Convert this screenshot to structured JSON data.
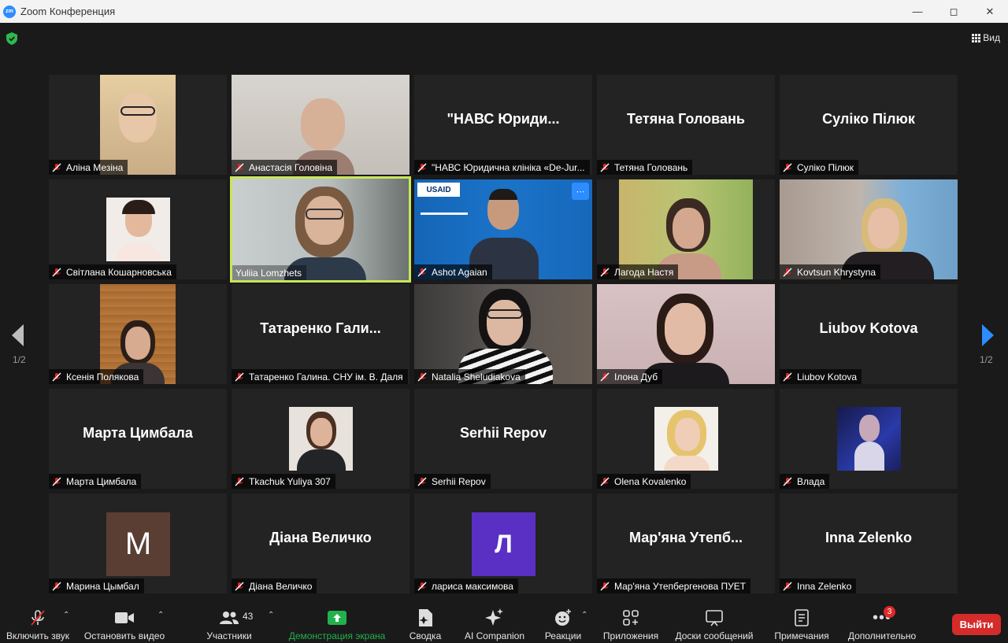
{
  "window": {
    "title": "Zoom Конференция",
    "logo": "zm"
  },
  "topbar": {
    "view_label": "Вид"
  },
  "navigation": {
    "page_left": "1/2",
    "page_right": "1/2"
  },
  "participants": [
    {
      "label": "Аліна Мезіна",
      "display": "video"
    },
    {
      "label": "Анастасія Головіна",
      "display": "video"
    },
    {
      "label": "\"НАВС Юридична клініка «De-Jur...",
      "display": "name",
      "big_name": "\"НАВС Юриди..."
    },
    {
      "label": "Тетяна Головань",
      "display": "name",
      "big_name": "Тетяна Головань"
    },
    {
      "label": "Суліко Пілюк",
      "display": "name",
      "big_name": "Суліко Пілюк"
    },
    {
      "label": "Світлана Кошарновська",
      "display": "video"
    },
    {
      "label": "Yuliia Lomzhets",
      "display": "video",
      "active_speaker": true
    },
    {
      "label": "Ashot Agaian",
      "display": "video",
      "logo_text": "USAID"
    },
    {
      "label": "Лагода Настя",
      "display": "video"
    },
    {
      "label": "Kovtsun Khrystyna",
      "display": "video"
    },
    {
      "label": "Ксенія Полякова",
      "display": "video"
    },
    {
      "label": "Татаренко Галина. СНУ ім. В. Даля",
      "display": "name",
      "big_name": "Татаренко Гали..."
    },
    {
      "label": "Natalia Sheludiakova",
      "display": "video"
    },
    {
      "label": "Ілона Дуб",
      "display": "video"
    },
    {
      "label": "Liubov Kotova",
      "display": "name",
      "big_name": "Liubov Kotova"
    },
    {
      "label": "Марта Цимбала",
      "display": "name",
      "big_name": "Марта Цимбала"
    },
    {
      "label": "Tkachuk Yuliya 307",
      "display": "video"
    },
    {
      "label": "Serhii Repov",
      "display": "name",
      "big_name": "Serhii Repov"
    },
    {
      "label": "Olena Kovalenko",
      "display": "video"
    },
    {
      "label": "Влада",
      "display": "video"
    },
    {
      "label": "Марина Цымбал",
      "display": "avatar",
      "avatar_letter": "M",
      "avatar_color": "#5a3e34"
    },
    {
      "label": "Діана Величко",
      "display": "name",
      "big_name": "Діана Величко"
    },
    {
      "label": "лариса максимова",
      "display": "avatar",
      "avatar_letter": "Л",
      "avatar_color": "#5a2fc4"
    },
    {
      "label": "Мар'яна Утепбергенова ПУЕТ",
      "display": "name",
      "big_name": "Мар'яна Утепб..."
    },
    {
      "label": "Inna Zelenko",
      "display": "name",
      "big_name": "Inna Zelenko"
    }
  ],
  "toolbar": {
    "mute": "Включить звук",
    "video": "Остановить видео",
    "participants": "Участники",
    "participants_count": "43",
    "share": "Демонстрация экрана",
    "summary": "Сводка",
    "ai": "AI Companion",
    "reactions": "Реакции",
    "apps": "Приложения",
    "whiteboards": "Доски сообщений",
    "notes": "Примечания",
    "more": "Дополнительно",
    "more_badge": "3",
    "leave": "Выйти"
  },
  "colors": {
    "accent_share": "#22b14c",
    "active_speaker": "#c8e65a",
    "leave": "#d42b2b",
    "mic_muted": "#e02828",
    "blue": "#2d8cff"
  }
}
